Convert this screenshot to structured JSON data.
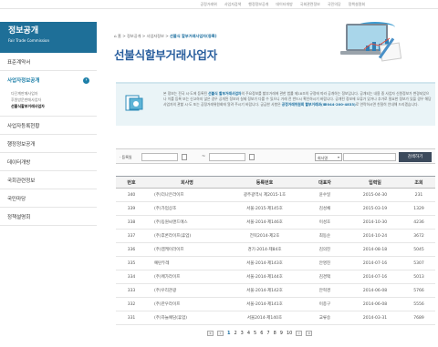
{
  "top_nav": [
    "공정거래위",
    "사업자검색",
    "행정정보공개",
    "데이터개방",
    "국회관련정보",
    "국민의당",
    "정책설명회"
  ],
  "sidebar": {
    "title": "정보공개",
    "subtitle": "Fair Trade Commission",
    "items": [
      {
        "label": "표준계약서"
      },
      {
        "label": "사업자정보공개"
      },
      {
        "label": "사업자등록현황"
      },
      {
        "label": "행정정보공개"
      },
      {
        "label": "데이터개방"
      },
      {
        "label": "국회관련정보"
      },
      {
        "label": "국민마당"
      },
      {
        "label": "정책설명회"
      }
    ],
    "sub_items": [
      "다단계판매사업자",
      "후원방문판매사업자",
      "선불식할부거래사업자"
    ]
  },
  "breadcrumb": {
    "home": "홈",
    "path": " > 정보공개 > 사업자정보 > ",
    "current": "선불식 할부거래사업자(등록)"
  },
  "page_title": "선불식할부거래사업자",
  "info": {
    "line1_pre": "본 정보는 전국 시·도에 등록된 ",
    "line1_bold": "선불식 할부거래사업자",
    "line1_post": "의 주요정보를 할부거래에 관한 법률 제18조의 규정에 따라 공개하는 정보입니다.",
    "line2": "공개되는 내용 중 사업자 신원정보가 변경되었으나 이를 등록 또는 신고하지 않은 경우 공개된 정보와 실제 정보가 다를 수 있으니 거래 전 반드시 확인하시기 바랍니다.",
    "line3": "공개된 정보에 오류가 있거나 추가로 필요한 정보가 있을 경우 해당 사업자의 관할 시·도 또는 공정거래위원회에 알려 주시기 바랍니다.",
    "line4_pre": "궁금한 사항은 ",
    "line4_bold": "공정거래위원회 할부거래과(☎044-200-4833)",
    "line4_post": "로 연락하시면 친절히 안내해 드리겠습니다."
  },
  "search": {
    "label": "· 등록일",
    "dash": "~",
    "select": "회사명",
    "button": "검색하기"
  },
  "table": {
    "headers": [
      "번호",
      "회사명",
      "등록번호",
      "대표자",
      "입력일",
      "조회"
    ],
    "rows": [
      {
        "no": "340",
        "company": "(주)더나은라이프",
        "reg": "광주광역시 제2015-1호",
        "ceo": "윤수일",
        "date": "2015-04-30",
        "views": "231"
      },
      {
        "no": "339",
        "company": "(주)가업상조",
        "reg": "서울-2015-제145호",
        "ceo": "김성채",
        "date": "2015-03-19",
        "views": "1329"
      },
      {
        "no": "338",
        "company": "(주)동원씨앤드에스",
        "reg": "서울-2014-제146호",
        "ceo": "이성호",
        "date": "2014-10-30",
        "views": "4236"
      },
      {
        "no": "337",
        "company": "(주)후론라이프(휴업)",
        "reg": "전북2014-제2호",
        "ceo": "최동순",
        "date": "2014-10-24",
        "views": "3672"
      },
      {
        "no": "336",
        "company": "(주)엠케이라이프",
        "reg": "경기-2014-제84호",
        "ceo": "김의진",
        "date": "2014-08-18",
        "views": "5045"
      },
      {
        "no": "335",
        "company": "예탄두레",
        "reg": "서울-2014-제143호",
        "ceo": "안명진",
        "date": "2014-07-16",
        "views": "5307"
      },
      {
        "no": "334",
        "company": "(주)메가라이프",
        "reg": "서울-2014-제144호",
        "ceo": "김경택",
        "date": "2014-07-16",
        "views": "5013"
      },
      {
        "no": "333",
        "company": "(주)우리관광",
        "reg": "서울-2014-제142호",
        "ceo": "안혁경",
        "date": "2014-06-08",
        "views": "5766"
      },
      {
        "no": "332",
        "company": "(주)한우라이프",
        "reg": "서울-2014-제141호",
        "ceo": "이종구",
        "date": "2014-06-08",
        "views": "5556"
      },
      {
        "no": "331",
        "company": "(주)하늘예담(휴업)",
        "reg": "서울2014-제140호",
        "ceo": "교류승",
        "date": "2014-03-31",
        "views": "7689"
      }
    ]
  },
  "pager": {
    "first": "«",
    "prev": "‹",
    "pages": [
      "1",
      "2",
      "3",
      "4",
      "5",
      "6",
      "7",
      "8",
      "9",
      "10"
    ],
    "next": "›",
    "last": "»"
  },
  "colors": {
    "brand": "#1e6f98",
    "title": "#2a5f9e",
    "button": "#3c4a5c"
  }
}
